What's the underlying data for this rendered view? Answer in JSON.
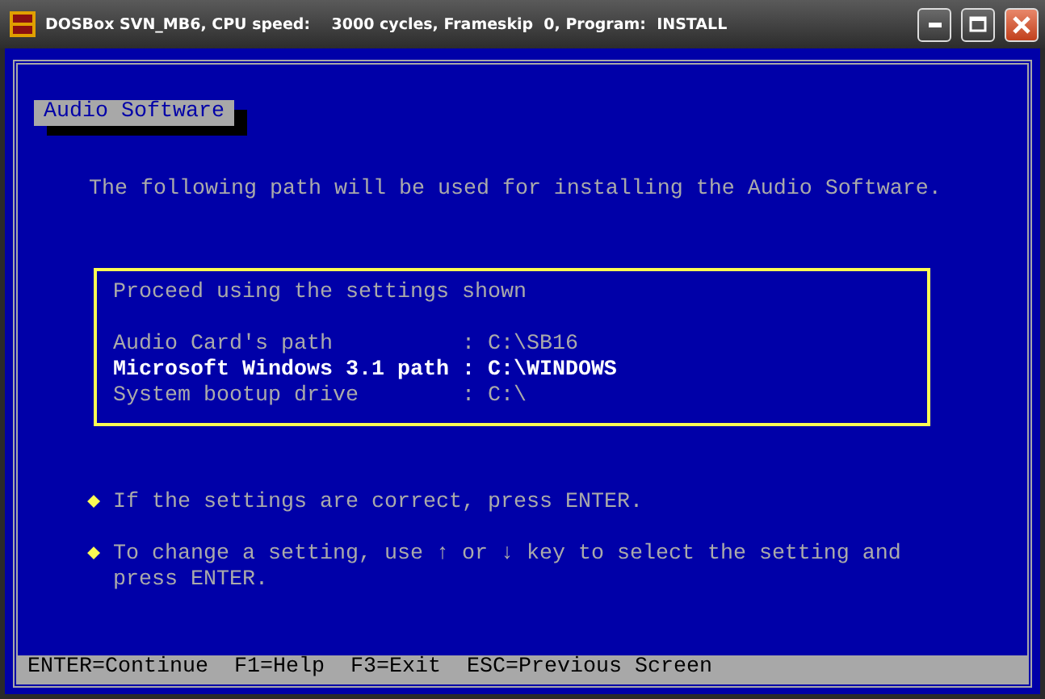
{
  "window": {
    "title": "DOSBox SVN_MB6, CPU speed:    3000 cycles, Frameskip  0, Program:  INSTALL"
  },
  "heading": "Audio Software",
  "description": "The following path will be used for installing the Audio Software.",
  "settings_box": {
    "title": "Proceed using the settings shown",
    "rows": [
      {
        "label": "Audio Card's path",
        "separator": ":",
        "value": "C:\\SB16",
        "selected": false
      },
      {
        "label": "Microsoft Windows 3.1 path",
        "separator": ":",
        "value": "C:\\WINDOWS",
        "selected": true
      },
      {
        "label": "System bootup drive",
        "separator": ":",
        "value": "C:\\",
        "selected": false
      }
    ]
  },
  "instructions": [
    {
      "bullet": "◆",
      "text": "If the settings are correct, press ENTER."
    },
    {
      "bullet": "◆",
      "text": "To change a setting, use ↑ or ↓ key to select the setting and press ENTER."
    }
  ],
  "status_bar": [
    "ENTER=Continue",
    "F1=Help",
    "F3=Exit",
    "ESC=Previous Screen"
  ]
}
